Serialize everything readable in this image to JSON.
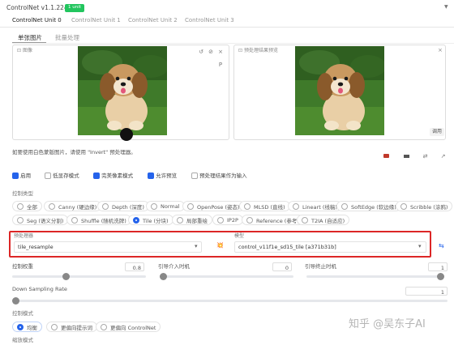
{
  "header": {
    "title": "ControlNet v1.1.224",
    "badge": "1 unit",
    "collapse_glyph": "▼",
    "accent": "#22c55e"
  },
  "unit_tabs": [
    {
      "label": "ControlNet Unit 0",
      "active": true
    },
    {
      "label": "ControlNet Unit 1",
      "active": false
    },
    {
      "label": "ControlNet Unit 2",
      "active": false
    },
    {
      "label": "ControlNet Unit 3",
      "active": false
    }
  ],
  "sub_tabs": [
    {
      "label": "单张图片",
      "active": true
    },
    {
      "label": "批量处理",
      "active": false
    }
  ],
  "image_panel": {
    "label": "图像",
    "tools": [
      "↺",
      "⊘",
      "×",
      "P"
    ]
  },
  "preview_panel": {
    "label": "预处理结果预览",
    "close": "×",
    "corner_label": "调用"
  },
  "hint_text": "如要使用白色蒙版图片，请使用 \"Invert\" 预处理器。",
  "action_icons": [
    "camera-icon",
    "minus-icon",
    "swap-icon",
    "arrow-icon"
  ],
  "options": [
    {
      "label": "启用",
      "checked": true
    },
    {
      "label": "低显存模式",
      "checked": false
    },
    {
      "label": "完美像素模式",
      "checked": true
    },
    {
      "label": "允许预览",
      "checked": true
    },
    {
      "label": "预处理结果作为输入",
      "checked": false
    }
  ],
  "control_type": {
    "label": "控制类型",
    "row1": [
      "全部",
      "Canny (硬边缘)",
      "Depth (深度)",
      "Normal",
      "OpenPose (姿态)",
      "MLSD (直线)",
      "Lineart (线稿)",
      "SoftEdge (软边缘)",
      "Scribble (涂鸦)"
    ],
    "row2": [
      "Seg (语义分割)",
      "Shuffle (随机洗牌)",
      "Tile (分块)",
      "局部重绘",
      "IP2P",
      "Reference (参考)",
      "T2IA (自适应)"
    ],
    "selected": "Tile (分块)"
  },
  "preprocessor": {
    "label": "预处理器",
    "value": "tile_resample",
    "caret": "▾"
  },
  "explode_icon": "💥",
  "model": {
    "label": "模型",
    "value": "control_v11f1e_sd15_tile [a371b31b]",
    "caret": "▾",
    "refresh_icon": "⇆"
  },
  "highlight_color": "#dc2626",
  "sliders": [
    {
      "label": "控制权重",
      "value": "0.8",
      "fraction": 0.4
    },
    {
      "label": "引导介入时机",
      "value": "0",
      "fraction": 0.0
    },
    {
      "label": "引导终止时机",
      "value": "1",
      "fraction": 1.0
    }
  ],
  "downsampling": {
    "label": "Down Sampling Rate",
    "value": "1",
    "fraction": 0.0
  },
  "control_mode": {
    "label": "控制模式",
    "options": [
      "均衡",
      "更偏向提示词",
      "更偏向 ControlNet"
    ],
    "selected": "均衡"
  },
  "resize_mode": {
    "label": "缩放模式"
  },
  "watermark": "知乎 @吴东子AI"
}
